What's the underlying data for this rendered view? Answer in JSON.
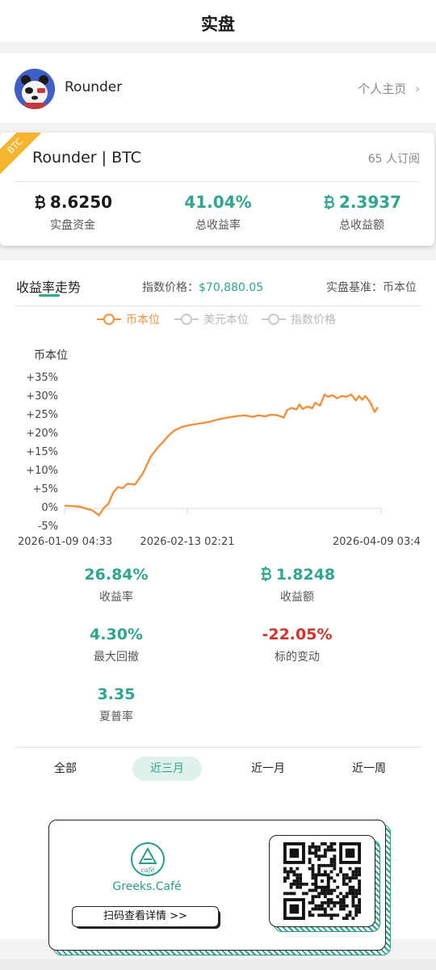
{
  "header": {
    "title": "实盘"
  },
  "profile": {
    "name": "Rounder",
    "home_link": "个人主页"
  },
  "portfolio": {
    "badge": "BTC",
    "title": "Rounder | BTC",
    "subscribers": "65 人订阅",
    "stats": [
      {
        "value": "8.6250",
        "label": "实盘资金",
        "btc": true,
        "color": "#1a1a1a"
      },
      {
        "value": "41.04%",
        "label": "总收益率",
        "btc": false,
        "color": "#2fa58d"
      },
      {
        "value": "2.3937",
        "label": "总收益额",
        "btc": true,
        "color": "#2fa58d"
      }
    ]
  },
  "trend": {
    "tab": "收益率走势",
    "index_label": "指数价格：",
    "index_value": "$70,880.05",
    "basis": "实盘基准：币本位",
    "legend": [
      {
        "label": "币本位",
        "color": "#f0913f",
        "active": true
      },
      {
        "label": "美元本位",
        "color": "#c9c9c9",
        "active": false
      },
      {
        "label": "指数价格",
        "color": "#c9c9c9",
        "active": false
      }
    ]
  },
  "chart_data": {
    "type": "line",
    "ylabel": "币本位",
    "ylim": [
      -5,
      35
    ],
    "yticks": [
      "+35%",
      "+30%",
      "+25%",
      "+20%",
      "+15%",
      "+10%",
      "+5%",
      "0%",
      "-5%"
    ],
    "xticks": [
      "2026-01-09 04:33",
      "2026-02-13 02:21",
      "2026-04-09 03:4"
    ],
    "series": [
      {
        "color": "#f0913f",
        "x": [
          0,
          5,
          10,
          14,
          18,
          22,
          25,
          28,
          31,
          34,
          37,
          40,
          45,
          50,
          55,
          60,
          63,
          66,
          70,
          75,
          80,
          86,
          92,
          98,
          104,
          110,
          115,
          120,
          124,
          128,
          132,
          136,
          140,
          142,
          145,
          148,
          150,
          152,
          155,
          158,
          160,
          163,
          166,
          168,
          171,
          174,
          177,
          180,
          183,
          186,
          188,
          190,
          192,
          195,
          198,
          200
        ],
        "y": [
          0.3,
          0.2,
          0.0,
          -0.5,
          -1.0,
          -2.3,
          -0.3,
          0.8,
          3.8,
          5.3,
          5.0,
          6.2,
          6.0,
          9.0,
          13.5,
          16.2,
          17.5,
          19.0,
          20.5,
          21.5,
          22.0,
          22.4,
          22.8,
          23.5,
          24.0,
          24.4,
          24.6,
          24.2,
          24.6,
          24.3,
          24.8,
          24.6,
          24.0,
          26.0,
          26.6,
          26.2,
          27.5,
          26.3,
          27.0,
          26.5,
          28.0,
          27.2,
          30.2,
          29.6,
          30.0,
          29.2,
          29.8,
          29.6,
          30.2,
          28.6,
          29.8,
          28.8,
          29.8,
          28.2,
          25.5,
          26.8
        ]
      }
    ]
  },
  "metrics": [
    {
      "value": "26.84%",
      "label": "收益率",
      "btc": false,
      "color": "#2fa58d"
    },
    {
      "value": "1.8248",
      "label": "收益额",
      "btc": true,
      "color": "#2fa58d"
    },
    {
      "value": "4.30%",
      "label": "最大回撤",
      "btc": false,
      "color": "#2fa58d"
    },
    {
      "value": "-22.05%",
      "label": "标的变动",
      "btc": false,
      "color": "#d0342c"
    },
    {
      "value": "3.35",
      "label": "夏普率",
      "btc": false,
      "color": "#2fa58d"
    }
  ],
  "ranges": [
    {
      "label": "全部",
      "active": false
    },
    {
      "label": "近三月",
      "active": true
    },
    {
      "label": "近一月",
      "active": false
    },
    {
      "label": "近一周",
      "active": false
    }
  ],
  "promo": {
    "brand": "Greeks.Café",
    "logo_text": "café",
    "cta": "扫码查看详情 >>"
  },
  "colors": {
    "accent": "#2fa58d",
    "orange": "#f0913f",
    "red": "#d0342c",
    "badge": "#f5b52e"
  }
}
